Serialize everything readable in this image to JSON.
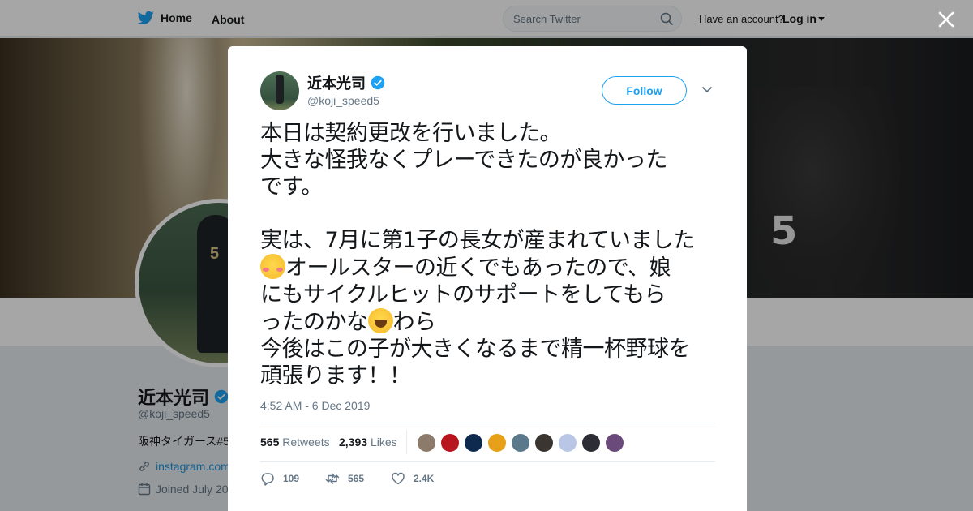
{
  "nav": {
    "home_label": "Home",
    "about_label": "About",
    "search_placeholder": "Search Twitter",
    "have_account": "Have an account?",
    "login_label": "Log in"
  },
  "profile": {
    "name": "近本光司",
    "handle": "@koji_speed5",
    "bio": "阪神タイガース#5",
    "link": "instagram.com",
    "joined": "Joined July 20"
  },
  "tweet": {
    "author_name": "近本光司",
    "author_handle": "@koji_speed5",
    "follow_label": "Follow",
    "text_part1": "本日は契約更改を行いました。\n大きな怪我なくプレーできたのが良かった\nです。\n\n実は、7月に第1子の長女が産まれていました\n",
    "emoji1": "smiling-face-with-blush",
    "text_part2": "オールスターの近くでもあったので、娘\nにもサイクルヒットのサポートをしてもら\nったのかな",
    "emoji2": "grinning-squinting-face",
    "text_part3": "わら\n今後はこの子が大きくなるまで精一杯野球を\n頑張ります！！",
    "timestamp": "4:52 AM - 6 Dec 2019",
    "retweets_count": "565",
    "retweets_label": "Retweets",
    "likes_count": "2,393",
    "likes_label": "Likes",
    "reply_count": "109",
    "retweet_action_count": "565",
    "like_action_count": "2.4K"
  },
  "liker_colors": [
    "#8c7b6a",
    "#b8161e",
    "#0e2a4f",
    "#e6a019",
    "#5a7a8c",
    "#3a3530",
    "#b9c6e6",
    "#2d2d35",
    "#6a4a7a"
  ],
  "colors": {
    "accent": "#1da1f2",
    "text": "#14171a",
    "muted": "#657786"
  }
}
